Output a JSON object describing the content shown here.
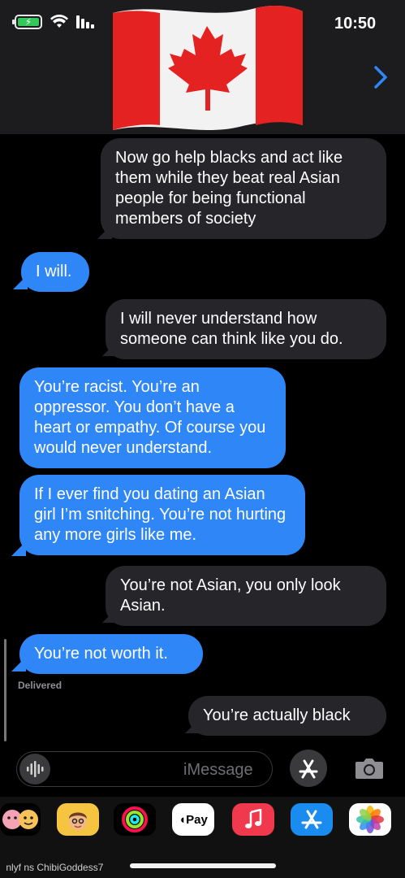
{
  "status_bar": {
    "time": "10:50"
  },
  "header": {
    "contact_avatar": "canada-flag-icon",
    "back_icon": "chevron-icon"
  },
  "messages": [
    {
      "side": "received",
      "color": "gray",
      "text": "Now go help blacks and act like them while they beat real Asian people for being functional members of society"
    },
    {
      "side": "sent",
      "color": "blue",
      "text": "I will."
    },
    {
      "side": "received",
      "color": "gray",
      "text": "I will never understand how someone can think like you do."
    },
    {
      "side": "sent",
      "color": "blue",
      "text": "You’re racist. You’re an oppressor. You don’t have a heart or empathy. Of course you would never understand."
    },
    {
      "side": "sent",
      "color": "blue",
      "text": "If I ever find you dating an Asian girl I’m snitching. You’re not hurting any more girls like me."
    },
    {
      "side": "received",
      "color": "gray",
      "text": "You’re not Asian, you only look Asian."
    },
    {
      "side": "sent",
      "color": "blue",
      "text": "You’re not worth it."
    },
    {
      "side": "received",
      "color": "gray",
      "text": "You’re actually black"
    }
  ],
  "delivered_label": "Delivered",
  "input": {
    "placeholder": "iMessage"
  },
  "app_drawer": [
    "photos-icon",
    "app-store-icon",
    "music-icon",
    "apple-pay-icon",
    "activity-icon",
    "memoji-icon",
    "memoji-stickers-icon"
  ],
  "apple_pay_label": "Pay",
  "watermark": " nlyf  ns ChibiGoddess7"
}
